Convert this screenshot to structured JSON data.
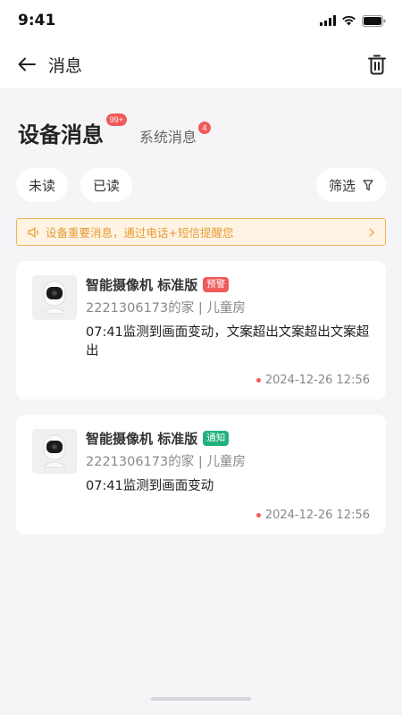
{
  "status_bar": {
    "time": "9:41"
  },
  "nav": {
    "title": "消息"
  },
  "tabs": [
    {
      "label": "设备消息",
      "badge": "99+"
    },
    {
      "label": "系统消息",
      "badge": "4"
    }
  ],
  "filters": {
    "unread": "未读",
    "read": "已读",
    "filter": "筛选"
  },
  "notice": {
    "text": "设备重要消息，通过电话+短信提醒您"
  },
  "messages": [
    {
      "title": "智能摄像机 标准版",
      "tag": "预警",
      "tag_color": "#f05a5a",
      "location": "2221306173的家 | 儿童房",
      "content": "07:41监测到画面变动，文案超出文案超出文案超出",
      "time": "2024-12-26 12:56"
    },
    {
      "title": "智能摄像机 标准版",
      "tag": "通知",
      "tag_color": "#20b27a",
      "location": "2221306173的家 | 儿童房",
      "content": "07:41监测到画面变动",
      "time": "2024-12-26 12:56"
    }
  ],
  "colors": {
    "accent_red": "#f05a5a",
    "accent_green": "#20b27a",
    "notice_orange": "#e69a33"
  }
}
